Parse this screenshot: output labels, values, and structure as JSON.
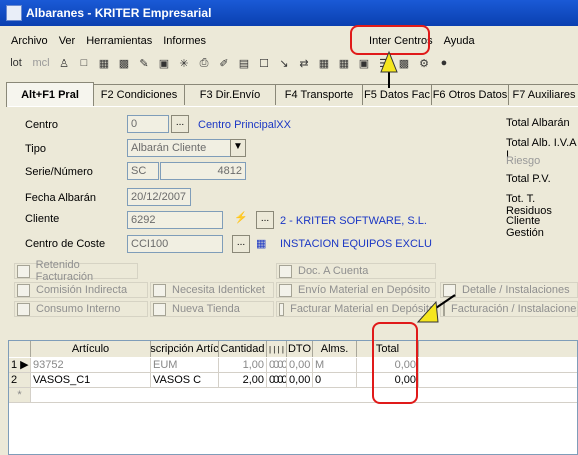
{
  "window": {
    "title": "Albaranes - KRITER Empresarial"
  },
  "menu": [
    {
      "label": "Archivo",
      "key": "A"
    },
    {
      "label": "Ver",
      "key": "V"
    },
    {
      "label": "Herramientas",
      "key": "H"
    },
    {
      "label": "Informes",
      "key": "I"
    },
    {
      "label": "Inter Centros",
      "key": ""
    },
    {
      "label": "Ayuda",
      "key": ""
    }
  ],
  "toolbar": {
    "lot_label": "lot",
    "mcl_label": "mcl"
  },
  "tabs": [
    "Alt+F1 Pral",
    "F2 Condiciones",
    "F3 Dir.Envío",
    "F4 Transporte",
    "F5 Datos Fac",
    "F6 Otros Datos",
    "F7 Auxiliares"
  ],
  "form": {
    "centro_label": "Centro",
    "centro_value": "0",
    "centro_name": "Centro PrincipalXX",
    "tipo_label": "Tipo",
    "tipo_value": "Albarán Cliente",
    "serie_label": "Serie/Número",
    "serie_value": "SC",
    "numero_value": "4812",
    "fecha_label": "Fecha Albarán",
    "fecha_value": "20/12/2007",
    "cliente_label": "Cliente",
    "cliente_value": "6292",
    "cliente_name": "2 - KRITER SOFTWARE, S.L.",
    "coste_label": "Centro de Coste",
    "coste_value": "CCI100",
    "coste_name": "INSTACION EQUIPOS EXCLUSIV"
  },
  "totals": [
    "Total Albarán",
    "Total Alb. I.V.A I",
    "Riesgo",
    "Total P.V.",
    "Tot. T. Residuos",
    "Cliente Gestión"
  ],
  "checks": {
    "retenido": "Retenido Facturación",
    "comision": "Comisión Indirecta",
    "consumo": "Consumo Interno",
    "necesita": "Necesita Identicket",
    "nueva": "Nueva Tienda",
    "doc_cuenta": "Doc. A Cuenta",
    "envio_deposito": "Envío Material en Depósito",
    "facturar_deposito": "Facturar Material en Depósito",
    "detalle": "Detalle / Instalaciones",
    "facturacion": "Facturación / Instalaciones"
  },
  "grid": {
    "headers": {
      "articulo": "Artículo",
      "descripcion": "scripción Artíc",
      "cantidad": "Cantidad",
      "dto": "DTO",
      "alms": "Alms.",
      "total": "Total"
    },
    "rows": [
      {
        "num": "1",
        "articulo": "93752",
        "descripcion": "EUM",
        "cantidad": "1,00",
        "mid": "0000",
        "dto": "0,00",
        "alms": "M",
        "total": "0,00"
      },
      {
        "num": "2",
        "articulo": "VASOS_C1",
        "descripcion": "VASOS C",
        "cantidad": "2,00",
        "mid": "0000",
        "dto": "0,00",
        "alms": "0",
        "total": "0,00"
      }
    ],
    "new_row_marker": "*"
  },
  "colors": {
    "highlight_red": "#e01a1a",
    "arrow_yellow": "#f5e61e",
    "link_blue": "#1a36c4",
    "title_blue": "#0a3fb0"
  }
}
